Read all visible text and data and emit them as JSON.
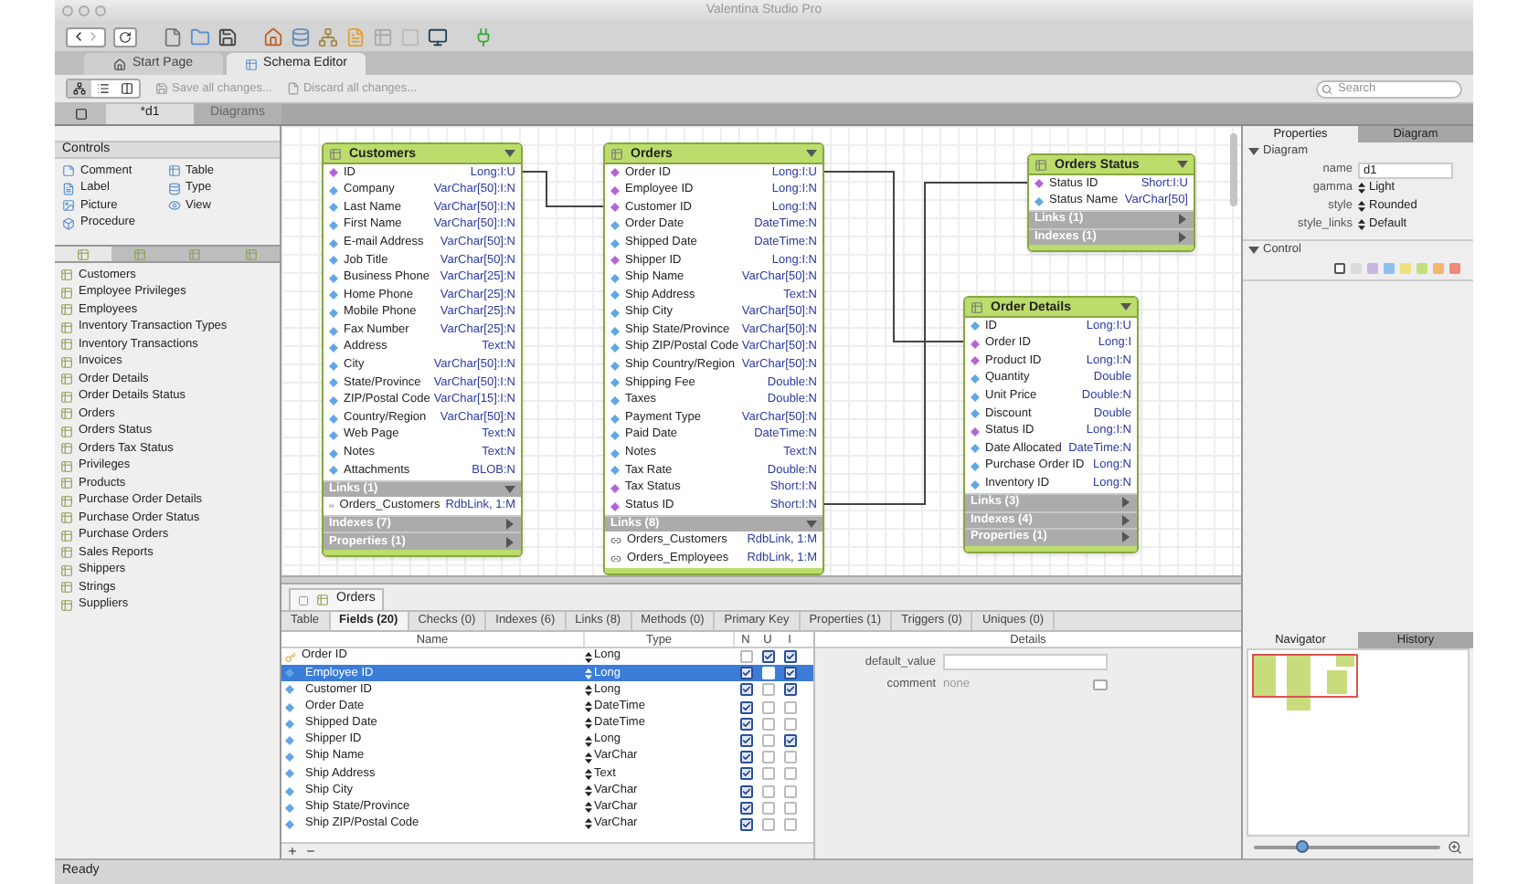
{
  "window": {
    "title": "Valentina Studio Pro"
  },
  "tabs": [
    {
      "label": "Start Page",
      "selected": false
    },
    {
      "label": "Schema Editor",
      "selected": true
    }
  ],
  "actions": [
    "Save all changes...",
    "Discard all changes..."
  ],
  "search": {
    "placeholder": "Search"
  },
  "doc_tabs": [
    {
      "label": "*d1",
      "selected": true
    },
    {
      "label": "Diagrams",
      "selected": false
    }
  ],
  "controls": {
    "title": "Controls",
    "items": [
      {
        "label": "Comment",
        "kind": "comment"
      },
      {
        "label": "Label",
        "kind": "label"
      },
      {
        "label": "Picture",
        "kind": "picture"
      },
      {
        "label": "Procedure",
        "kind": "procedure"
      },
      {
        "label": "Table",
        "kind": "table"
      },
      {
        "label": "Type",
        "kind": "type"
      },
      {
        "label": "View",
        "kind": "view"
      }
    ]
  },
  "palette_tabs": [
    {
      "selected": true
    },
    {
      "selected": false
    },
    {
      "selected": false
    },
    {
      "selected": false
    }
  ],
  "tables_list": [
    "Customers",
    "Employee Privileges",
    "Employees",
    "Inventory Transaction Types",
    "Inventory Transactions",
    "Invoices",
    "Order Details",
    "Order Details Status",
    "Orders",
    "Orders Status",
    "Orders Tax Status",
    "Privileges",
    "Products",
    "Purchase Order Details",
    "Purchase Order Status",
    "Purchase Orders",
    "Sales Reports",
    "Shippers",
    "Strings",
    "Suppliers"
  ],
  "diagram": {
    "tables": [
      {
        "name": "Customers",
        "fields": [
          {
            "name": "ID",
            "type": "Long:I:U",
            "kind": "key"
          },
          {
            "name": "Company",
            "type": "VarChar[50]:I:N",
            "kind": "field"
          },
          {
            "name": "Last Name",
            "type": "VarChar[50]:I:N",
            "kind": "field"
          },
          {
            "name": "First Name",
            "type": "VarChar[50]:I:N",
            "kind": "field"
          },
          {
            "name": "E-mail Address",
            "type": "VarChar[50]:N",
            "kind": "field"
          },
          {
            "name": "Job Title",
            "type": "VarChar[50]:N",
            "kind": "field"
          },
          {
            "name": "Business Phone",
            "type": "VarChar[25]:N",
            "kind": "field"
          },
          {
            "name": "Home Phone",
            "type": "VarChar[25]:N",
            "kind": "field"
          },
          {
            "name": "Mobile Phone",
            "type": "VarChar[25]:N",
            "kind": "field"
          },
          {
            "name": "Fax Number",
            "type": "VarChar[25]:N",
            "kind": "field"
          },
          {
            "name": "Address",
            "type": "Text:N",
            "kind": "field"
          },
          {
            "name": "City",
            "type": "VarChar[50]:I:N",
            "kind": "field"
          },
          {
            "name": "State/Province",
            "type": "VarChar[50]:I:N",
            "kind": "field"
          },
          {
            "name": "ZIP/Postal Code",
            "type": "VarChar[15]:I:N",
            "kind": "field"
          },
          {
            "name": "Country/Region",
            "type": "VarChar[50]:N",
            "kind": "field"
          },
          {
            "name": "Web Page",
            "type": "Text:N",
            "kind": "field"
          },
          {
            "name": "Notes",
            "type": "Text:N",
            "kind": "field"
          },
          {
            "name": "Attachments",
            "type": "BLOB:N",
            "kind": "field"
          }
        ],
        "sections": [
          {
            "label": "Links (1)",
            "expanded": true,
            "items": [
              {
                "name": "Orders_Customers",
                "type": "RdbLink, 1:M"
              }
            ]
          },
          {
            "label": "Indexes (7)",
            "expanded": false
          },
          {
            "label": "Properties (1)",
            "expanded": false
          }
        ]
      },
      {
        "name": "Orders",
        "fields": [
          {
            "name": "Order ID",
            "type": "Long:I:U",
            "kind": "key"
          },
          {
            "name": "Employee ID",
            "type": "Long:I:N",
            "kind": "key"
          },
          {
            "name": "Customer ID",
            "type": "Long:I:N",
            "kind": "key"
          },
          {
            "name": "Order Date",
            "type": "DateTime:N",
            "kind": "field"
          },
          {
            "name": "Shipped Date",
            "type": "DateTime:N",
            "kind": "field"
          },
          {
            "name": "Shipper ID",
            "type": "Long:I:N",
            "kind": "key"
          },
          {
            "name": "Ship Name",
            "type": "VarChar[50]:N",
            "kind": "field"
          },
          {
            "name": "Ship Address",
            "type": "Text:N",
            "kind": "field"
          },
          {
            "name": "Ship City",
            "type": "VarChar[50]:N",
            "kind": "field"
          },
          {
            "name": "Ship State/Province",
            "type": "VarChar[50]:N",
            "kind": "field"
          },
          {
            "name": "Ship ZIP/Postal Code",
            "type": "VarChar[50]:N",
            "kind": "field"
          },
          {
            "name": "Ship Country/Region",
            "type": "VarChar[50]:N",
            "kind": "field"
          },
          {
            "name": "Shipping Fee",
            "type": "Double:N",
            "kind": "field"
          },
          {
            "name": "Taxes",
            "type": "Double:N",
            "kind": "field"
          },
          {
            "name": "Payment Type",
            "type": "VarChar[50]:N",
            "kind": "field"
          },
          {
            "name": "Paid Date",
            "type": "DateTime:N",
            "kind": "field"
          },
          {
            "name": "Notes",
            "type": "Text:N",
            "kind": "field"
          },
          {
            "name": "Tax Rate",
            "type": "Double:N",
            "kind": "field"
          },
          {
            "name": "Tax Status",
            "type": "Short:I:N",
            "kind": "key"
          },
          {
            "name": "Status ID",
            "type": "Short:I:N",
            "kind": "key"
          }
        ],
        "sections": [
          {
            "label": "Links (8)",
            "expanded": true,
            "items": [
              {
                "name": "Orders_Customers",
                "type": "RdbLink, 1:M"
              },
              {
                "name": "Orders_Employees",
                "type": "RdbLink, 1:M"
              }
            ]
          }
        ]
      },
      {
        "name": "Orders Status",
        "fields": [
          {
            "name": "Status ID",
            "type": "Short:I:U",
            "kind": "key"
          },
          {
            "name": "Status Name",
            "type": "VarChar[50]",
            "kind": "field"
          }
        ],
        "sections": [
          {
            "label": "Links (1)",
            "expanded": false
          },
          {
            "label": "Indexes (1)",
            "expanded": false
          }
        ]
      },
      {
        "name": "Order Details",
        "fields": [
          {
            "name": "ID",
            "type": "Long:I:U",
            "kind": "field"
          },
          {
            "name": "Order ID",
            "type": "Long:I",
            "kind": "key"
          },
          {
            "name": "Product ID",
            "type": "Long:I:N",
            "kind": "key"
          },
          {
            "name": "Quantity",
            "type": "Double",
            "kind": "field"
          },
          {
            "name": "Unit Price",
            "type": "Double:N",
            "kind": "field"
          },
          {
            "name": "Discount",
            "type": "Double",
            "kind": "field"
          },
          {
            "name": "Status ID",
            "type": "Long:I:N",
            "kind": "key"
          },
          {
            "name": "Date Allocated",
            "type": "DateTime:N",
            "kind": "field"
          },
          {
            "name": "Purchase Order ID",
            "type": "Long:N",
            "kind": "field"
          },
          {
            "name": "Inventory ID",
            "type": "Long:N",
            "kind": "field"
          }
        ],
        "sections": [
          {
            "label": "Links (3)",
            "expanded": false
          },
          {
            "label": "Indexes (4)",
            "expanded": false
          },
          {
            "label": "Properties (1)",
            "expanded": false
          }
        ]
      }
    ]
  },
  "editor": {
    "title": "Orders",
    "tabs": [
      {
        "label": "Table",
        "selected": false
      },
      {
        "label": "Fields (20)",
        "selected": true
      },
      {
        "label": "Checks (0)",
        "selected": false
      },
      {
        "label": "Indexes (6)",
        "selected": false
      },
      {
        "label": "Links (8)",
        "selected": false
      },
      {
        "label": "Methods (0)",
        "selected": false
      },
      {
        "label": "Primary Key",
        "selected": false
      },
      {
        "label": "Properties (1)",
        "selected": false
      },
      {
        "label": "Triggers (0)",
        "selected": false
      },
      {
        "label": "Uniques (0)",
        "selected": false
      }
    ],
    "columns": [
      "Name",
      "Type",
      "N",
      "U",
      "I"
    ],
    "rows": [
      {
        "name": "Order ID",
        "type": "Long",
        "kind": "primary",
        "selected": false,
        "n": false,
        "u": true,
        "i": true
      },
      {
        "name": "Employee ID",
        "type": "Long",
        "kind": "field",
        "selected": true,
        "n": true,
        "u": false,
        "i": true
      },
      {
        "name": "Customer ID",
        "type": "Long",
        "kind": "field",
        "selected": false,
        "n": true,
        "u": false,
        "i": true
      },
      {
        "name": "Order Date",
        "type": "DateTime",
        "kind": "field",
        "selected": false,
        "n": true,
        "u": false,
        "i": false
      },
      {
        "name": "Shipped Date",
        "type": "DateTime",
        "kind": "field",
        "selected": false,
        "n": true,
        "u": false,
        "i": false
      },
      {
        "name": "Shipper ID",
        "type": "Long",
        "kind": "field",
        "selected": false,
        "n": true,
        "u": false,
        "i": true
      },
      {
        "name": "Ship Name",
        "type": "VarChar",
        "kind": "field",
        "selected": false,
        "n": true,
        "u": false,
        "i": false
      },
      {
        "name": "Ship Address",
        "type": "Text",
        "kind": "field",
        "selected": false,
        "n": true,
        "u": false,
        "i": false
      },
      {
        "name": "Ship City",
        "type": "VarChar",
        "kind": "field",
        "selected": false,
        "n": true,
        "u": false,
        "i": false
      },
      {
        "name": "Ship State/Province",
        "type": "VarChar",
        "kind": "field",
        "selected": false,
        "n": true,
        "u": false,
        "i": false
      },
      {
        "name": "Ship ZIP/Postal Code",
        "type": "VarChar",
        "kind": "field",
        "selected": false,
        "n": true,
        "u": false,
        "i": false
      }
    ],
    "details": {
      "title": "Details",
      "default_label": "default_value",
      "comment_label": "comment",
      "comment_value": "none"
    }
  },
  "properties": {
    "tabs": [
      {
        "label": "Properties",
        "selected": true
      },
      {
        "label": "Diagram",
        "selected": false
      }
    ],
    "sections": [
      {
        "title": "Diagram",
        "expanded": true,
        "props": [
          {
            "name": "name",
            "value": "d1",
            "kind": "input"
          },
          {
            "name": "gamma",
            "value": "Light",
            "kind": "select"
          },
          {
            "name": "style",
            "value": "Rounded",
            "kind": "select"
          },
          {
            "name": "style_links",
            "value": "Default",
            "kind": "select"
          }
        ]
      },
      {
        "title": "Control",
        "expanded": true,
        "swatches": [
          {
            "color": "#ffffff",
            "selected": true
          },
          {
            "color": "#dcdcdc",
            "selected": false
          },
          {
            "color": "#c8b4e0",
            "selected": false
          },
          {
            "color": "#8cc0ee",
            "selected": false
          },
          {
            "color": "#f0e07c",
            "selected": false
          },
          {
            "color": "#c4de7c",
            "selected": false
          },
          {
            "color": "#f4b66c",
            "selected": false
          },
          {
            "color": "#f0887c",
            "selected": false
          }
        ]
      }
    ]
  },
  "navigator": {
    "tabs": [
      {
        "label": "Navigator",
        "selected": true
      },
      {
        "label": "History",
        "selected": false
      }
    ],
    "zoom": {
      "level": 0.25
    }
  },
  "status_bar": "Ready"
}
